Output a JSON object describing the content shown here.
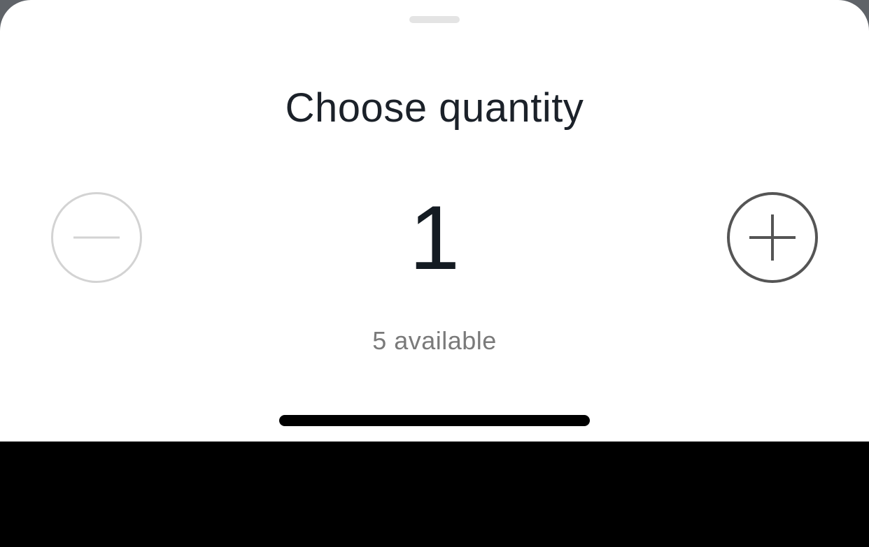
{
  "sheet": {
    "title": "Choose quantity",
    "quantity_value": "1",
    "availability_text": "5 available"
  },
  "stepper": {
    "decrement_icon": "minus-icon",
    "increment_icon": "plus-icon",
    "decrement_enabled": false,
    "increment_enabled": true
  },
  "colors": {
    "sheet_background": "#ffffff",
    "title_text": "#1b2129",
    "disabled_control": "#d3d3d3",
    "enabled_control": "#555555",
    "secondary_text": "#7a7a7a"
  }
}
